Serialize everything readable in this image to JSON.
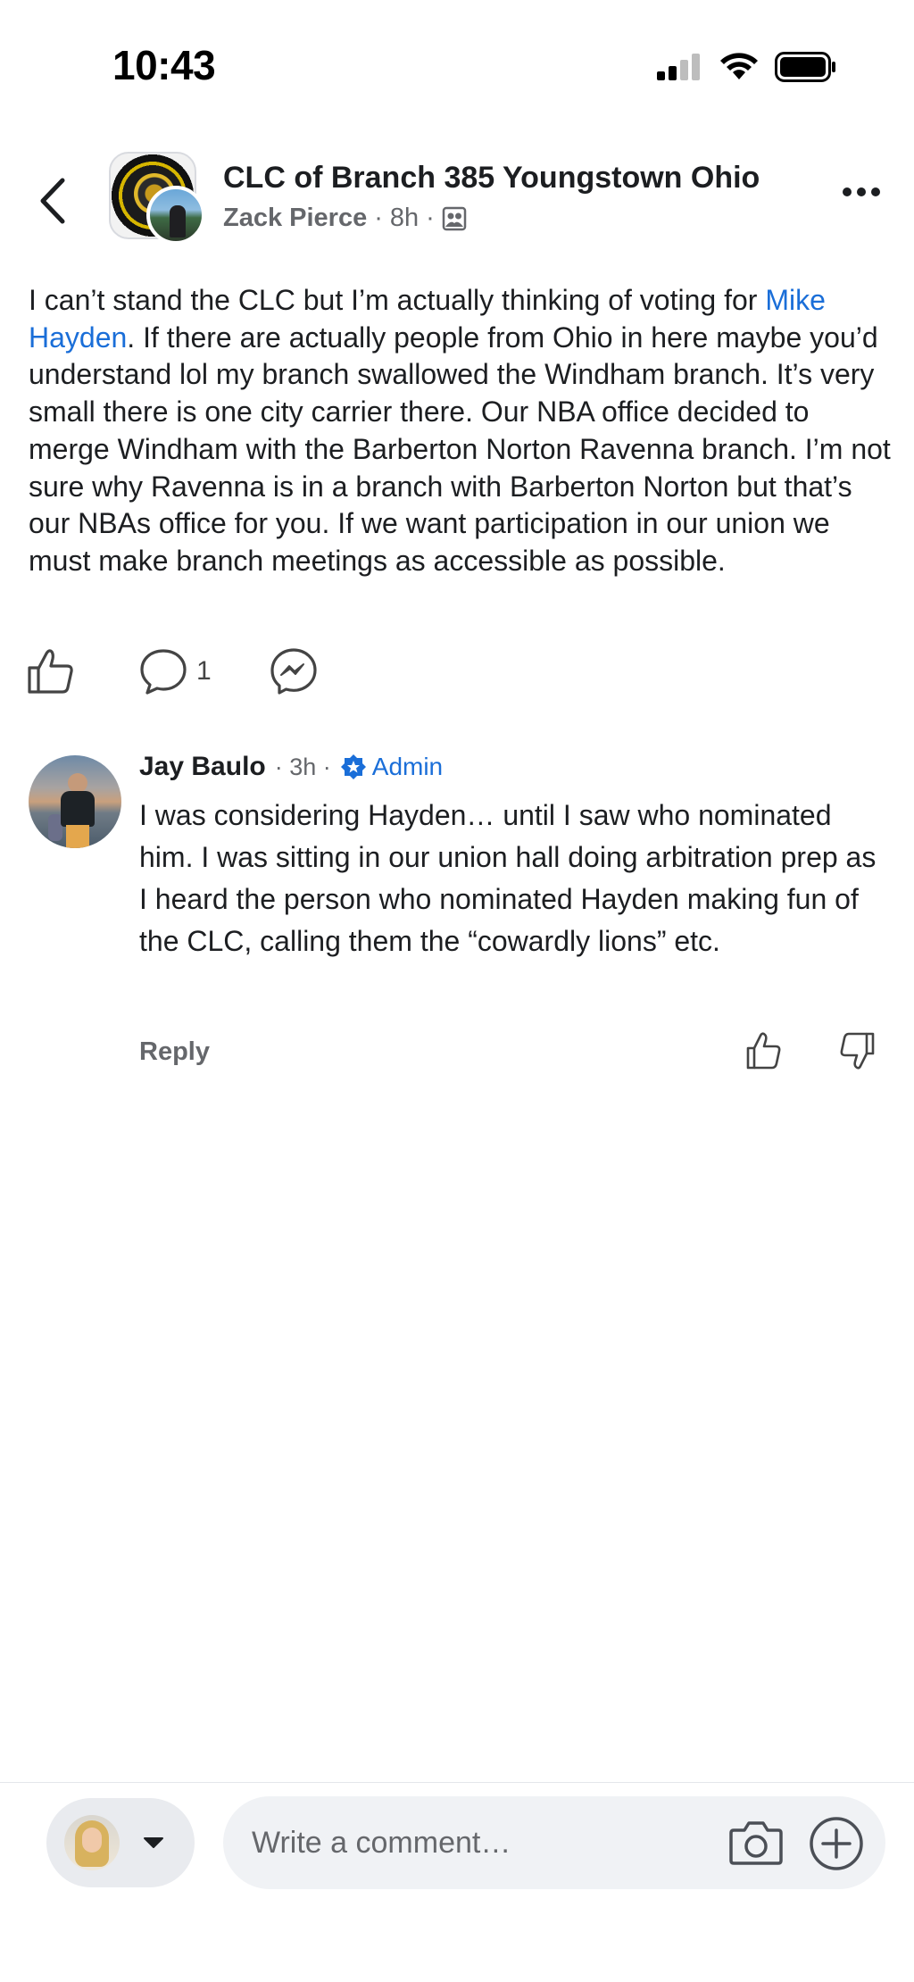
{
  "status_bar": {
    "time": "10:43"
  },
  "header": {
    "group_name": "CLC of Branch 385 Youngstown Ohio",
    "author": "Zack Pierce",
    "time_ago": "8h",
    "separator": "·",
    "privacy_icon": "members-group-icon"
  },
  "post": {
    "text_before_mention": "I can’t stand the CLC but I’m actually thinking of voting for ",
    "mention": "Mike Hayden",
    "text_after_mention": ". If there are actually people from Ohio in here maybe you’d understand lol my branch swallowed the Windham branch. It’s very small there is one city carrier there. Our NBA office decided to merge Windham with the Barberton Norton Ravenna branch. I’m not sure why Ravenna is in a branch with Barberton Norton but that’s our NBAs office for you. If we want participation in our union we must make branch meetings as accessible as possible.",
    "comment_count": "1"
  },
  "comment": {
    "author": "Jay Baulo",
    "time_ago": "· 3h ·",
    "badge": "Admin",
    "text": "I was considering Hayden… until I saw who nominated him. I was sitting in our union hall doing arbitration prep as I heard the person who nominated Hayden making fun of the CLC, calling them the “cowardly lions” etc.",
    "reply_label": "Reply"
  },
  "composer": {
    "placeholder": "Write a comment…"
  },
  "colors": {
    "accent_blue": "#1a6ed8",
    "muted_text": "#65676b",
    "input_bg": "#f0f2f5"
  }
}
